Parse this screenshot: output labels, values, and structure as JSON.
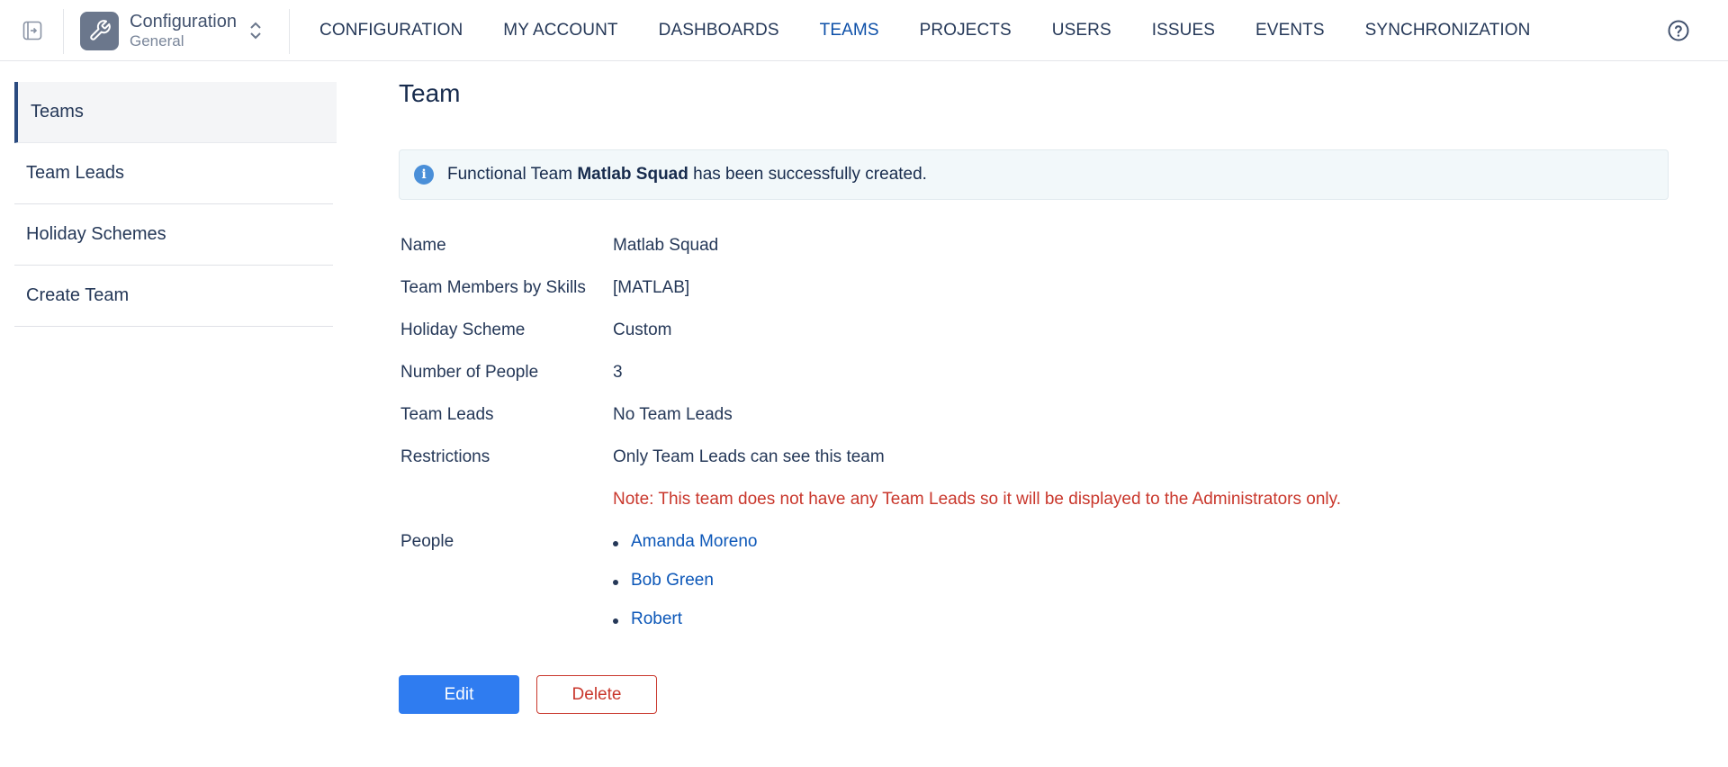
{
  "app": {
    "title": "Configuration",
    "subtitle": "General"
  },
  "nav": {
    "items": [
      {
        "label": "CONFIGURATION",
        "active": false
      },
      {
        "label": "MY ACCOUNT",
        "active": false
      },
      {
        "label": "DASHBOARDS",
        "active": false
      },
      {
        "label": "TEAMS",
        "active": true
      },
      {
        "label": "PROJECTS",
        "active": false
      },
      {
        "label": "USERS",
        "active": false
      },
      {
        "label": "ISSUES",
        "active": false
      },
      {
        "label": "EVENTS",
        "active": false
      },
      {
        "label": "SYNCHRONIZATION",
        "active": false
      }
    ],
    "help_icon": "help-circle-icon"
  },
  "sidebar": {
    "items": [
      {
        "label": "Teams",
        "active": true
      },
      {
        "label": "Team Leads",
        "active": false
      },
      {
        "label": "Holiday Schemes",
        "active": false
      },
      {
        "label": "Create Team",
        "active": false
      }
    ]
  },
  "main": {
    "title": "Team",
    "banner": {
      "prefix": "Functional Team ",
      "team_name": "Matlab Squad",
      "suffix": " has been successfully created."
    },
    "details": {
      "name_label": "Name",
      "name_value": "Matlab Squad",
      "skills_label": "Team Members by Skills",
      "skills_value": "[MATLAB]",
      "holiday_label": "Holiday Scheme",
      "holiday_value": "Custom",
      "people_count_label": "Number of People",
      "people_count_value": "3",
      "leads_label": "Team Leads",
      "leads_value": "No Team Leads",
      "restrictions_label": "Restrictions",
      "restrictions_value": "Only Team Leads can see this team",
      "note": "Note: This team does not have any Team Leads so it will be displayed to the Administrators only.",
      "people_label": "People",
      "people": [
        "Amanda Moreno",
        "Bob Green",
        "Robert"
      ]
    },
    "actions": {
      "edit_label": "Edit",
      "delete_label": "Delete"
    }
  },
  "colors": {
    "accent": "#0c4fa8",
    "primary_button": "#2f7cf0",
    "danger": "#c9372c",
    "link": "#0c57b8"
  }
}
